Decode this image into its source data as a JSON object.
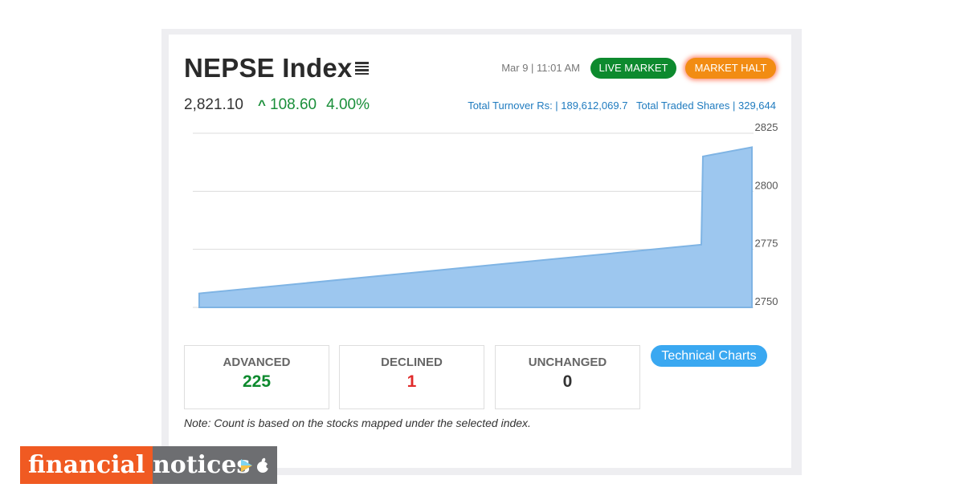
{
  "header": {
    "title": "NEPSE Index",
    "datetime": "Mar 9 | 11:01 AM",
    "live_market_label": "LIVE MARKET",
    "market_halt_label": "MARKET HALT"
  },
  "summary": {
    "index_value": "2,821.10",
    "change_arrow": "^",
    "change": "108.60",
    "change_percent": "4.00%",
    "turnover": "Total Turnover Rs: | 189,612,069.7",
    "traded_shares": "Total Traded Shares | 329,644"
  },
  "chart_data": {
    "type": "area",
    "x": [
      0,
      1,
      2
    ],
    "values": [
      2756,
      2777,
      2815,
      2819
    ],
    "ylim": [
      2750,
      2825
    ],
    "yticks": [
      "2825",
      "2800",
      "2775",
      "2750"
    ],
    "grid": true,
    "color": "#9dc7ef"
  },
  "stats": {
    "advanced_label": "ADVANCED",
    "advanced_value": "225",
    "declined_label": "DECLINED",
    "declined_value": "1",
    "unchanged_label": "UNCHANGED",
    "unchanged_value": "0",
    "advanced_color": "#0d8a2e",
    "declined_color": "#e02b2b",
    "unchanged_color": "#333333"
  },
  "actions": {
    "technical_charts_label": "Technical Charts"
  },
  "note": "Note: Count is based on the stocks mapped under the selected index.",
  "logo": {
    "part1": "financial",
    "part2": "notices",
    "icons": [
      "play-store-icon",
      "apple-icon"
    ]
  }
}
